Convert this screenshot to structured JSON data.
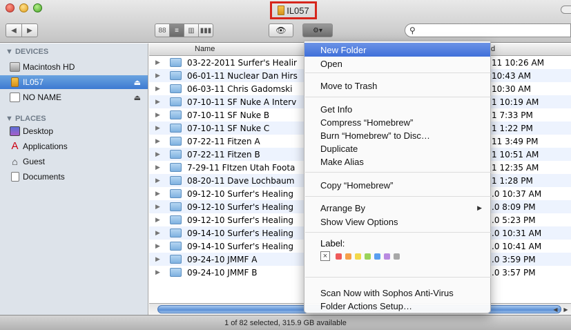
{
  "window": {
    "title": "IL057"
  },
  "toolbar": {
    "back": "◀",
    "forward": "▶",
    "views": [
      "88",
      "≡",
      "▥",
      "▮▮▮"
    ],
    "quicklook_glyph": "👁",
    "action_glyph": "⚙▾",
    "search_placeholder": "",
    "search_icon": "⚲"
  },
  "sidebar": {
    "devices_header": "▼ DEVICES",
    "places_header": "▼ PLACES",
    "devices": [
      {
        "label": "Macintosh HD",
        "icon": "hard-drive-icon"
      },
      {
        "label": "IL057",
        "icon": "usb-drive-icon",
        "eject": "⏏"
      },
      {
        "label": "NO NAME",
        "icon": "disk-icon",
        "eject": "⏏"
      }
    ],
    "places": [
      {
        "label": "Desktop",
        "icon": "desktop-icon"
      },
      {
        "label": "Applications",
        "icon": "applications-icon"
      },
      {
        "label": "Guest",
        "icon": "home-icon"
      },
      {
        "label": "Documents",
        "icon": "documents-icon"
      }
    ]
  },
  "list": {
    "col_name": "Name",
    "col_date": "d",
    "rows": [
      {
        "name": "03-22-2011 Surfer's Healir",
        "date": "11 10:26 AM"
      },
      {
        "name": "06-01-11 Nuclear Dan Hirs",
        "date": "10:43 AM"
      },
      {
        "name": "06-03-11 Chris Gadomski",
        "date": "10:30 AM"
      },
      {
        "name": "07-10-11 SF Nuke A Interv",
        "date": "1 10:19 AM"
      },
      {
        "name": "07-10-11 SF Nuke B",
        "date": "1 7:33 PM"
      },
      {
        "name": "07-10-11 SF Nuke C",
        "date": "1 1:22 PM"
      },
      {
        "name": "07-22-11 Fitzen A",
        "date": "11 3:49 PM"
      },
      {
        "name": "07-22-11 Fitzen B",
        "date": "1 10:51 AM"
      },
      {
        "name": "7-29-11 FItzen Utah Foota",
        "date": "1 12:35 AM"
      },
      {
        "name": "08-20-11 Dave Lochbaum",
        "date": "1 1:28 PM"
      },
      {
        "name": "09-12-10 Surfer's Healing",
        "date": ".0 10:37 AM"
      },
      {
        "name": "09-12-10 Surfer's Healing",
        "date": ".0 8:09 PM"
      },
      {
        "name": "09-12-10 Surfer's Healing",
        "date": ".0 5:23 PM"
      },
      {
        "name": "09-14-10 Surfer's Healing",
        "date": ".0 10:31 AM"
      },
      {
        "name": "09-14-10 Surfer's Healing",
        "date": ".0 10:41 AM"
      },
      {
        "name": "09-24-10 JMMF A",
        "date": ".0 3:59 PM"
      },
      {
        "name": "09-24-10 JMMF B",
        "date": ".0 3:57 PM"
      }
    ]
  },
  "status": "1 of 82 selected, 315.9 GB available",
  "menu": {
    "new_folder": "New Folder",
    "open": "Open",
    "move_to_trash": "Move to Trash",
    "get_info": "Get Info",
    "compress": "Compress “Homebrew”",
    "burn": "Burn “Homebrew” to Disc…",
    "duplicate": "Duplicate",
    "make_alias": "Make Alias",
    "copy": "Copy “Homebrew”",
    "arrange_by": "Arrange By",
    "show_view_options": "Show View Options",
    "label": "Label:",
    "label_none": "×",
    "label_colors": [
      "#ef5a5a",
      "#f5a04a",
      "#f2d84a",
      "#9ad35a",
      "#5a9ef0",
      "#b98ae0",
      "#a8a8a8"
    ],
    "scan": "Scan Now with Sophos Anti-Virus",
    "folder_actions": "Folder Actions Setup…"
  }
}
